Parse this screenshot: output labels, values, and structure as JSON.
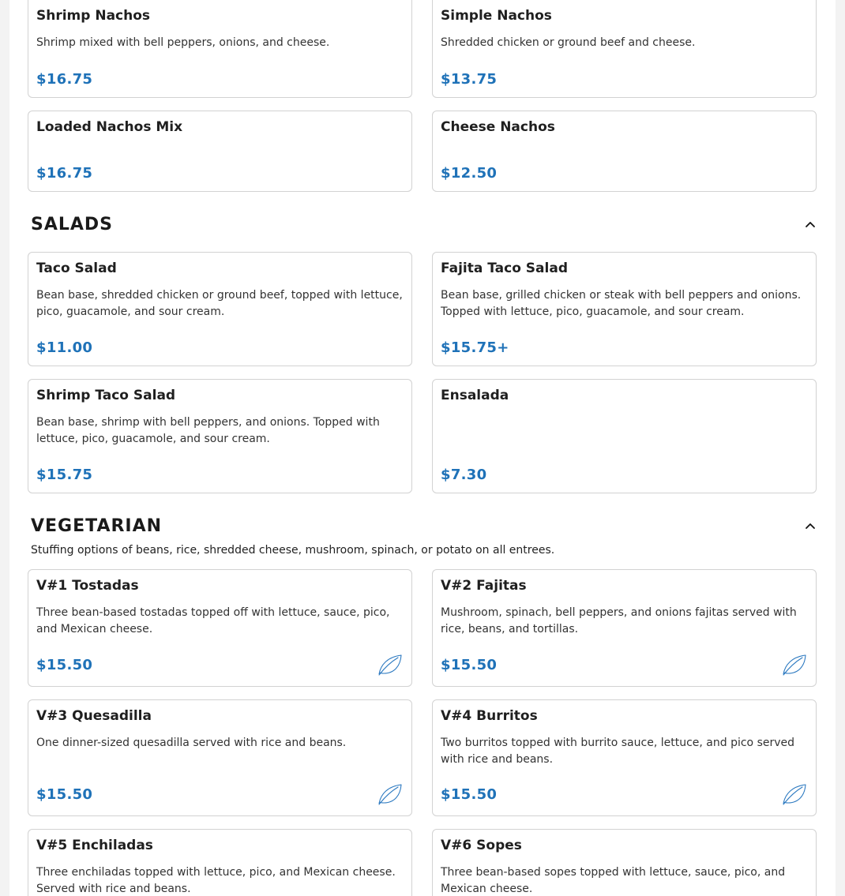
{
  "nachos": {
    "items": [
      {
        "name": "Shrimp Nachos",
        "desc": "Shrimp mixed with bell peppers, onions, and cheese.",
        "price": "$16.75"
      },
      {
        "name": "Simple Nachos",
        "desc": "Shredded chicken or ground beef and cheese.",
        "price": "$13.75"
      },
      {
        "name": "Loaded Nachos Mix",
        "desc": "",
        "price": "$16.75"
      },
      {
        "name": "Cheese Nachos",
        "desc": "",
        "price": "$12.50"
      }
    ]
  },
  "salads": {
    "title": "SALADS",
    "toggle_icon": "chevron-up-icon",
    "items": [
      {
        "name": "Taco Salad",
        "desc": "Bean base, shredded chicken or ground beef, topped with lettuce, pico, guacamole, and sour cream.",
        "price": "$11.00"
      },
      {
        "name": "Fajita Taco Salad",
        "desc": "Bean base, grilled chicken or steak with bell peppers and onions. Topped with lettuce, pico, guacamole, and sour cream.",
        "price": "$15.75+"
      },
      {
        "name": "Shrimp Taco Salad",
        "desc": "Bean base, shrimp with bell peppers, and onions. Topped with lettuce, pico, guacamole, and sour cream.",
        "price": "$15.75"
      },
      {
        "name": "Ensalada",
        "desc": "",
        "price": "$7.30"
      }
    ]
  },
  "vegetarian": {
    "title": "VEGETARIAN",
    "note": "Stuffing options of beans, rice, shredded cheese, mushroom, spinach, or potato on all entrees.",
    "toggle_icon": "chevron-up-icon",
    "badge_icon": "leaf-icon",
    "items": [
      {
        "name": "V#1 Tostadas",
        "desc": "Three bean-based tostadas topped off with lettuce, sauce, pico, and Mexican cheese.",
        "price": "$15.50"
      },
      {
        "name": "V#2 Fajitas",
        "desc": "Mushroom, spinach, bell peppers, and onions fajitas served with rice, beans, and tortillas.",
        "price": "$15.50"
      },
      {
        "name": "V#3 Quesadilla",
        "desc": "One dinner-sized quesadilla served with rice and beans.",
        "price": "$15.50"
      },
      {
        "name": "V#4 Burritos",
        "desc": "Two burritos topped with burrito sauce, lettuce, and pico served with rice and beans.",
        "price": "$15.50"
      },
      {
        "name": "V#5 Enchiladas",
        "desc": "Three enchiladas topped with lettuce, pico, and Mexican cheese. Served with rice and beans.",
        "price": ""
      },
      {
        "name": "V#6 Sopes",
        "desc": "Three bean-based sopes topped with lettuce, sauce, pico, and Mexican cheese.",
        "price": ""
      }
    ]
  },
  "colors": {
    "price": "#1f72b8",
    "border": "#d2d2d2",
    "leaf": "#2a78c0"
  }
}
